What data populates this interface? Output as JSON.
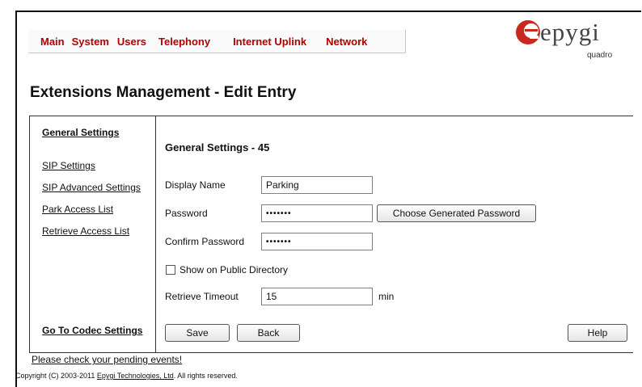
{
  "nav": {
    "items": [
      "Main",
      "System",
      "Users",
      "Telephony",
      "Internet Uplink",
      "Network"
    ]
  },
  "logo": {
    "word": "epygi",
    "sub": "quadro",
    "accent": "#c8281e"
  },
  "page": {
    "title": "Extensions Management - Edit Entry"
  },
  "sidebar": {
    "general": "General Settings",
    "sip": "SIP Settings",
    "sip_adv": "SIP Advanced Settings",
    "park": "Park Access List",
    "retrieve": "Retrieve Access List",
    "codec": "Go To Codec Settings"
  },
  "form": {
    "heading": "General Settings - 45",
    "display_name_label": "Display Name",
    "display_name_value": "Parking",
    "password_label": "Password",
    "password_value": "•••••••",
    "choose_password_button": "Choose Generated Password",
    "confirm_password_label": "Confirm Password",
    "confirm_password_value": "•••••••",
    "public_dir_label": "Show on Public Directory",
    "public_dir_checked": false,
    "retrieve_timeout_label": "Retrieve Timeout",
    "retrieve_timeout_value": "15",
    "retrieve_timeout_unit": "min"
  },
  "buttons": {
    "save": "Save",
    "back": "Back",
    "help": "Help"
  },
  "footer": {
    "pending": "Please check your pending events!",
    "copyright_prefix": "Copyright (C) 2003-2011 ",
    "company": "Epygi Technologies, Ltd",
    "copyright_suffix": ". All rights reserved."
  },
  "colors": {
    "nav_text": "#b30000"
  }
}
